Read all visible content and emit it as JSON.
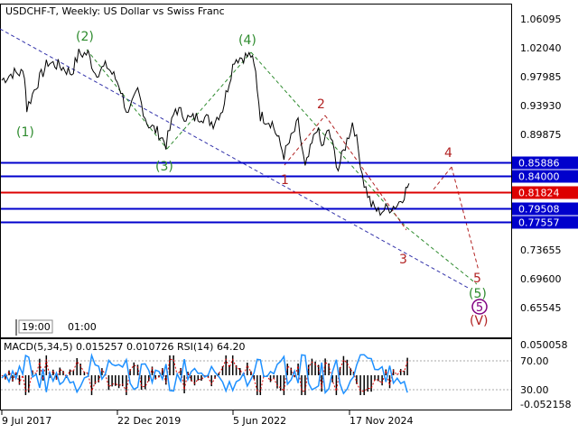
{
  "header": {
    "symbol_line": "USDCHF-T, Weekly:  US Dollar vs Swiss Franc"
  },
  "price_axis": {
    "ticks": [
      "1.06095",
      "1.02040",
      "0.97985",
      "0.93930",
      "0.89875",
      "0.73655",
      "0.69600",
      "0.65545"
    ]
  },
  "levels": [
    {
      "label": "0.85886",
      "value": 0.85886,
      "color": "#0000cc"
    },
    {
      "label": "0.84000",
      "value": 0.84,
      "color": "#0000cc"
    },
    {
      "label": "0.81824",
      "value": 0.81824,
      "color": "#dd0000"
    },
    {
      "label": "0.79508",
      "value": 0.79508,
      "color": "#0000cc"
    },
    {
      "label": "0.77557",
      "value": 0.77557,
      "color": "#0000cc"
    }
  ],
  "wave_labels": {
    "green": [
      "(1)",
      "(2)",
      "(3)",
      "(4)",
      "(5)"
    ],
    "red": [
      "1",
      "2",
      "3",
      "4",
      "5"
    ],
    "purple": "5",
    "red_roman": "(V)"
  },
  "time_buttons": [
    "19:00",
    "01:00"
  ],
  "indicator": {
    "label": "MACD(5,34,5) 0.015257 0.010726 RSI(14) 64.20",
    "ticks": [
      "0.050058",
      "70.00",
      "30.00",
      "-0.052158"
    ]
  },
  "date_axis": {
    "ticks": [
      "9 Jul 2017",
      "22 Dec 2019",
      "5 Jun 2022",
      "17 Nov 2024"
    ]
  },
  "colors": {
    "wave_green": "#2e8b2e",
    "wave_red": "#b22222",
    "wave_purple": "#800080",
    "trend_line": "#3333aa",
    "rsi_line": "#1e90ff",
    "macd_hist": "#000000",
    "signal_line": "#dd0000"
  },
  "chart_data": {
    "type": "line",
    "title": "USDCHF-T, Weekly:  US Dollar vs Swiss Franc",
    "x_ticks": [
      "9 Jul 2017",
      "22 Dec 2019",
      "5 Jun 2022",
      "17 Nov 2024"
    ],
    "ylim": [
      0.64,
      1.075
    ],
    "series": [
      {
        "values": [
          [
            2017.52,
            0.975
          ],
          [
            2017.75,
            0.985
          ],
          [
            2018.0,
            0.985
          ],
          [
            2018.05,
            0.935
          ],
          [
            2018.25,
            0.968
          ],
          [
            2018.5,
            1.0
          ],
          [
            2018.75,
            0.995
          ],
          [
            2019.0,
            0.985
          ],
          [
            2019.15,
            1.012
          ],
          [
            2019.35,
            1.012
          ],
          [
            2019.5,
            0.985
          ],
          [
            2019.75,
            0.995
          ],
          [
            2020.0,
            0.97
          ],
          [
            2020.2,
            0.925
          ],
          [
            2020.4,
            0.96
          ],
          [
            2020.6,
            0.915
          ],
          [
            2020.85,
            0.9
          ],
          [
            2021.0,
            0.885
          ],
          [
            2021.2,
            0.935
          ],
          [
            2021.5,
            0.92
          ],
          [
            2021.75,
            0.925
          ],
          [
            2022.0,
            0.915
          ],
          [
            2022.2,
            0.935
          ],
          [
            2022.45,
            1.005
          ],
          [
            2022.8,
            1.01
          ],
          [
            2022.9,
            0.985
          ],
          [
            2023.0,
            0.925
          ],
          [
            2023.25,
            0.915
          ],
          [
            2023.5,
            0.87
          ],
          [
            2023.8,
            0.915
          ],
          [
            2023.95,
            0.85
          ],
          [
            2024.2,
            0.91
          ],
          [
            2024.3,
            0.88
          ],
          [
            2024.45,
            0.905
          ],
          [
            2024.65,
            0.85
          ],
          [
            2024.95,
            0.915
          ],
          [
            2025.0,
            0.905
          ],
          [
            2025.2,
            0.83
          ],
          [
            2025.35,
            0.8
          ],
          [
            2025.5,
            0.79
          ],
          [
            2025.7,
            0.795
          ],
          [
            2025.9,
            0.8
          ],
          [
            2026.05,
            0.815
          ],
          [
            2026.15,
            0.83
          ]
        ]
      }
    ],
    "horizontal_levels": [
      0.85886,
      0.84,
      0.81824,
      0.79508,
      0.77557
    ],
    "forecast_path": [
      [
        2026.15,
        0.83
      ],
      [
        2026.45,
        0.865
      ],
      [
        2026.9,
        0.71
      ],
      [
        2027.1,
        0.695
      ],
      [
        2027.2,
        0.655
      ]
    ],
    "indicator_panel": {
      "macd": {
        "fast": 5,
        "slow": 34,
        "signal": 5,
        "main": 0.015257,
        "signal_value": 0.010726
      },
      "rsi": {
        "period": 14,
        "value": 64.2,
        "levels": [
          70.0,
          30.0
        ]
      },
      "ylim": [
        -0.052158,
        0.050058
      ]
    }
  }
}
